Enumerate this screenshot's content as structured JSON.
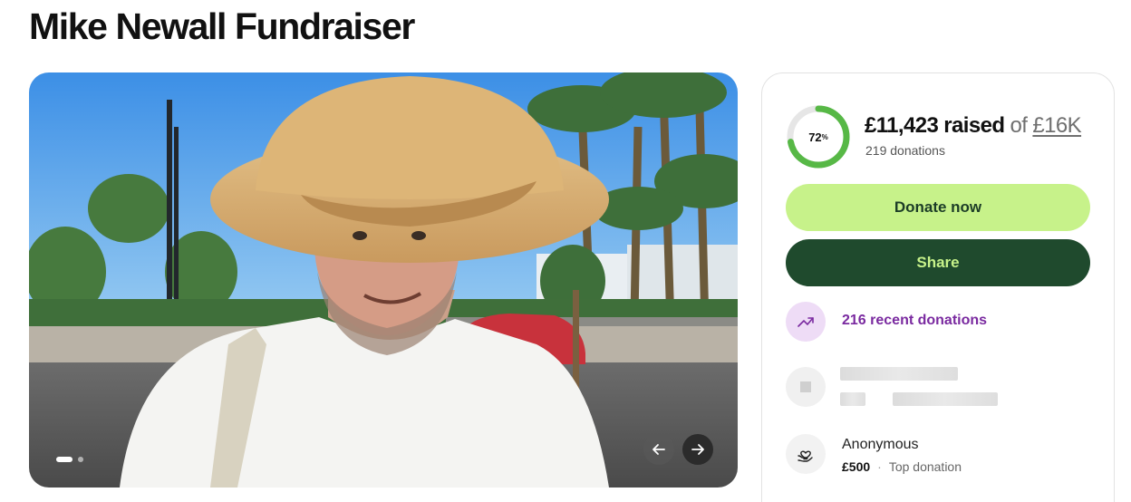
{
  "page": {
    "title": "Mike Newall Fundraiser"
  },
  "media": {
    "slides_total": 2,
    "active_slide": 1,
    "prev_label": "←",
    "next_label": "→"
  },
  "donation": {
    "progress_percent": 72,
    "progress_value": "72",
    "progress_suffix": "%",
    "raised_amount": "£11,423 raised",
    "raised_of": "of",
    "goal": "£16K",
    "donation_count": "219 donations",
    "accent_color": "#57b846",
    "track_color": "#e6e6e6"
  },
  "actions": {
    "donate_label": "Donate now",
    "share_label": "Share"
  },
  "recent": {
    "label": "216 recent donations",
    "icon": "trending-up-icon"
  },
  "top_donation": {
    "name": "Anonymous",
    "amount": "£500",
    "separator": "·",
    "tag": "Top donation",
    "icon": "heart-hand-icon"
  }
}
